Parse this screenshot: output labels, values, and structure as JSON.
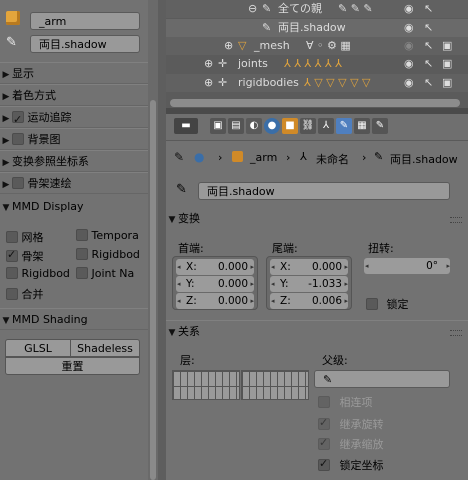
{
  "left_panel": {
    "armature_name": "_arm",
    "bone_name": "両目.shadow",
    "rows": [
      {
        "label": "显示",
        "checkbox": false
      },
      {
        "label": "着色方式",
        "checkbox": false
      },
      {
        "label": "运动追踪",
        "checkbox": true
      },
      {
        "label": "背景图",
        "checkbox": false
      },
      {
        "label": "变换参照坐标系",
        "checkbox": false
      },
      {
        "label": "骨架速绘",
        "checkbox": false
      }
    ],
    "mmd_display": {
      "title": "MMD Display",
      "items": [
        {
          "label": "网格",
          "checked": false
        },
        {
          "label": "Tempora",
          "checked": false
        },
        {
          "label": "骨架",
          "checked": true
        },
        {
          "label": "Rigidbod",
          "checked": false
        },
        {
          "label": "Rigidbod",
          "checked": false
        },
        {
          "label": "Joint Na",
          "checked": false
        },
        {
          "label": "合并",
          "checked": false
        }
      ]
    },
    "mmd_shading": {
      "title": "MMD Shading",
      "glsl": "GLSL",
      "shadeless": "Shadeless",
      "reset": "重置"
    }
  },
  "outliner": {
    "rows": [
      {
        "label": "全ての親"
      },
      {
        "label": "両目.shadow"
      },
      {
        "label": "_mesh"
      },
      {
        "label": "joints"
      },
      {
        "label": "rigidbodies"
      }
    ]
  },
  "properties": {
    "breadcrumb": {
      "object": "_arm",
      "armature": "未命名",
      "bone": "両目.shadow"
    },
    "bone_field": "両目.shadow",
    "transform": {
      "title": "变换",
      "head_label": "首端:",
      "tail_label": "尾端:",
      "roll_label": "扭转:",
      "head": [
        {
          "axis": "X:",
          "value": "0.000"
        },
        {
          "axis": "Y:",
          "value": "0.000"
        },
        {
          "axis": "Z:",
          "value": "0.000"
        }
      ],
      "tail": [
        {
          "axis": "X:",
          "value": "0.000"
        },
        {
          "axis": "Y:",
          "value": "-1.033"
        },
        {
          "axis": "Z:",
          "value": "0.006"
        }
      ],
      "roll": "0°",
      "lock_label": "锁定"
    },
    "relations": {
      "title": "关系",
      "layers_label": "层:",
      "parent_label": "父级:",
      "connected": "相连项",
      "inherit_rotation": "继承旋转",
      "inherit_scale": "继承缩放",
      "local_location": "锁定坐标"
    }
  }
}
